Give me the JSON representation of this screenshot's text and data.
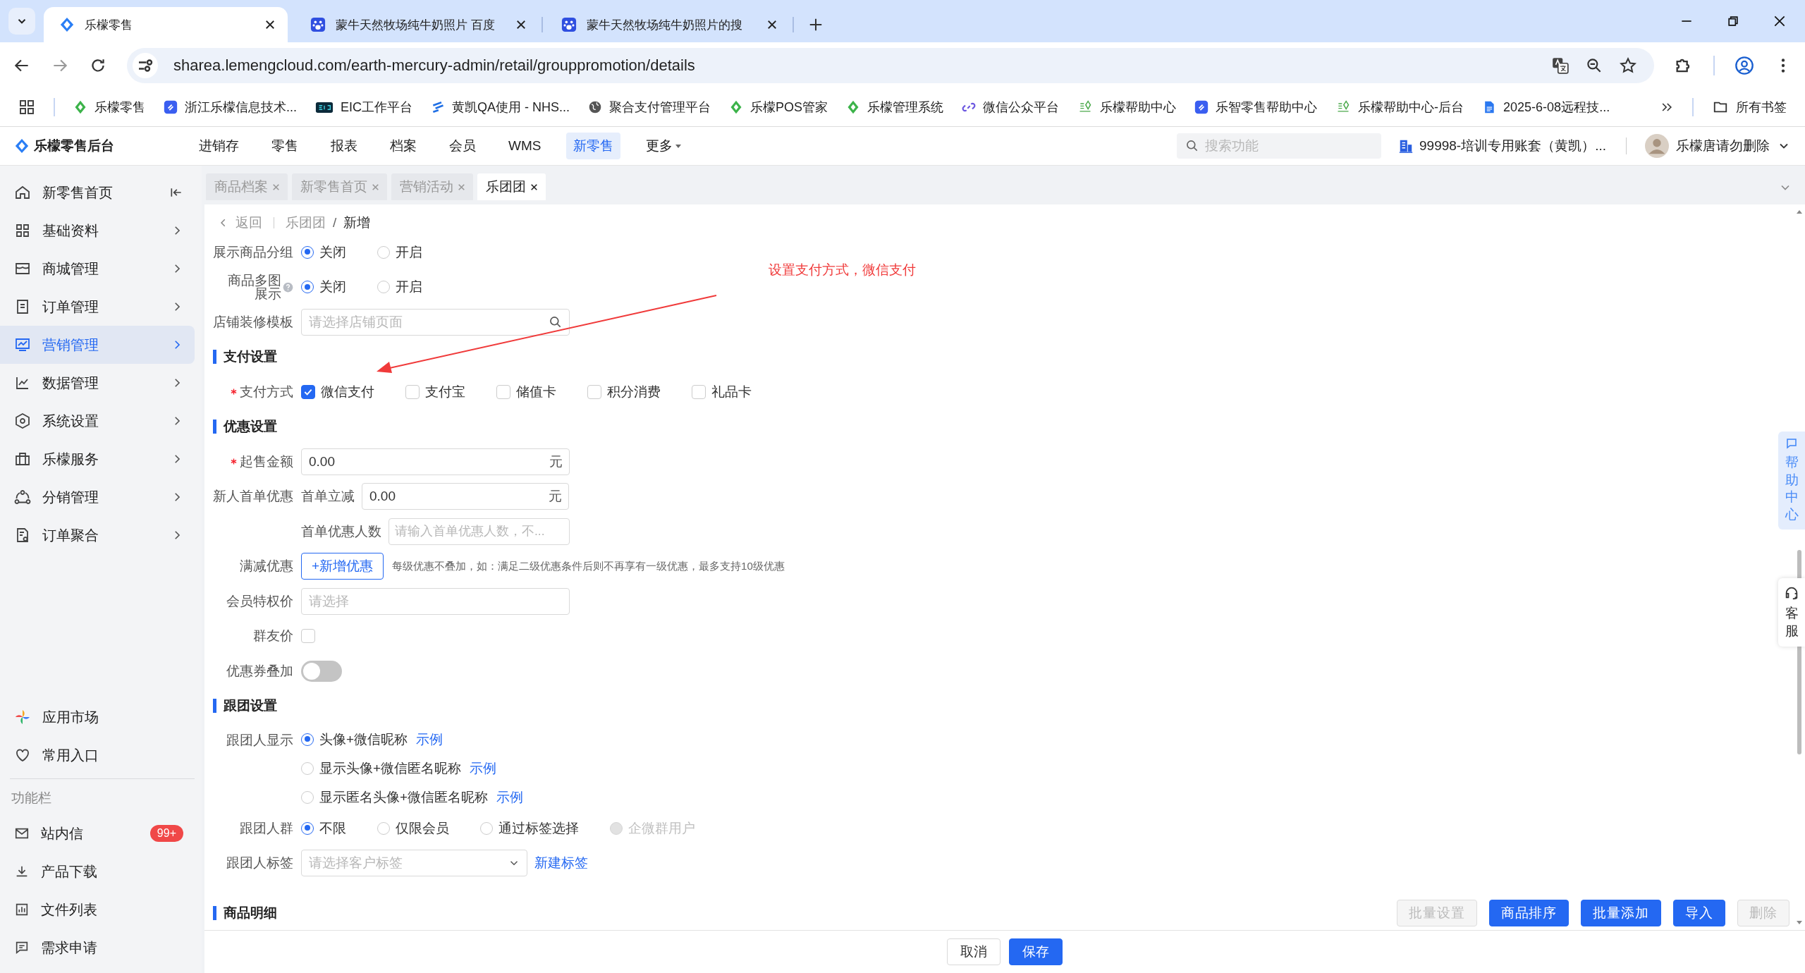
{
  "browser": {
    "tabs": [
      {
        "title": "乐檬零售",
        "selected": true
      },
      {
        "title": "蒙牛天然牧场纯牛奶照片 百度",
        "selected": false
      },
      {
        "title": "蒙牛天然牧场纯牛奶照片的搜",
        "selected": false
      }
    ],
    "url": "sharea.lemengcloud.com/earth-mercury-admin/retail/grouppromotion/details",
    "bookmarks": [
      {
        "label": "乐檬零售",
        "kind": "diamond"
      },
      {
        "label": "浙江乐檬信息技术...",
        "kind": "app"
      },
      {
        "label": "EIC工作平台",
        "kind": "badge"
      },
      {
        "label": "黄凯QA使用 - NHS...",
        "kind": "bars"
      },
      {
        "label": "聚合支付管理平台",
        "kind": "globe"
      },
      {
        "label": "乐檬POS管家",
        "kind": "diamond"
      },
      {
        "label": "乐檬管理系统",
        "kind": "diamond"
      },
      {
        "label": "微信公众平台",
        "kind": "link"
      },
      {
        "label": "乐檬帮助中心",
        "kind": "leaf"
      },
      {
        "label": "乐智零售帮助中心",
        "kind": "app"
      },
      {
        "label": "乐檬帮助中心-后台",
        "kind": "leaf"
      },
      {
        "label": "2025-6-08远程技...",
        "kind": "doc"
      }
    ],
    "all_bookmarks": "所有书签"
  },
  "header": {
    "title": "乐檬零售后台",
    "nav": [
      {
        "label": "进销存",
        "selected": false,
        "dropdown": false
      },
      {
        "label": "零售",
        "selected": false,
        "dropdown": false
      },
      {
        "label": "报表",
        "selected": false,
        "dropdown": false
      },
      {
        "label": "档案",
        "selected": false,
        "dropdown": false
      },
      {
        "label": "会员",
        "selected": false,
        "dropdown": false
      },
      {
        "label": "WMS",
        "selected": false,
        "dropdown": false
      },
      {
        "label": "新零售",
        "selected": true,
        "dropdown": false
      },
      {
        "label": "更多",
        "selected": false,
        "dropdown": true
      }
    ],
    "search": {
      "placeholder": "搜索功能"
    },
    "account": "99998-培训专用账套（黄凯）...",
    "user": "乐檬唐请勿删除"
  },
  "sidebar": {
    "home": "新零售首页",
    "items": [
      {
        "label": "基础资料",
        "selected": false
      },
      {
        "label": "商城管理",
        "selected": false
      },
      {
        "label": "订单管理",
        "selected": false
      },
      {
        "label": "营销管理",
        "selected": true
      },
      {
        "label": "数据管理",
        "selected": false
      },
      {
        "label": "系统设置",
        "selected": false
      },
      {
        "label": "乐檬服务",
        "selected": false
      },
      {
        "label": "分销管理",
        "selected": false
      },
      {
        "label": "订单聚合",
        "selected": false
      }
    ],
    "shortcuts": [
      "应用市场",
      "常用入口"
    ],
    "tools_title": "功能栏",
    "tools": [
      {
        "label": "站内信",
        "badge": "99+"
      },
      {
        "label": "产品下载"
      },
      {
        "label": "文件列表"
      },
      {
        "label": "需求申请"
      }
    ]
  },
  "page_tabs": [
    {
      "label": "商品档案",
      "selected": false
    },
    {
      "label": "新零售首页",
      "selected": false
    },
    {
      "label": "营销活动",
      "selected": false
    },
    {
      "label": "乐团团",
      "selected": true
    }
  ],
  "breadcrumb": {
    "back": "返回",
    "path": [
      "乐团团",
      "新增"
    ],
    "separator": "/"
  },
  "sections": [
    {
      "rows": [
        {
          "kind": "radio",
          "label": "展示商品分组",
          "required": false,
          "help": false,
          "options": [
            {
              "label": "关闭",
              "selected": true,
              "disabled": false
            },
            {
              "label": "开启",
              "selected": false,
              "disabled": false
            }
          ]
        },
        {
          "kind": "radio",
          "label": "商品多图展示",
          "required": false,
          "help": true,
          "options": [
            {
              "label": "关闭",
              "selected": true,
              "disabled": false
            },
            {
              "label": "开启",
              "selected": false,
              "disabled": false
            }
          ]
        },
        {
          "kind": "search",
          "label": "店铺装修模板",
          "required": false,
          "help": false,
          "placeholder": "请选择店铺页面"
        }
      ]
    },
    {
      "title": "支付设置",
      "rows": [
        {
          "kind": "checkboxes",
          "label": "支付方式",
          "required": true,
          "help": false,
          "options": [
            {
              "label": "微信支付",
              "checked": true
            },
            {
              "label": "支付宝",
              "checked": false
            },
            {
              "label": "储值卡",
              "checked": false
            },
            {
              "label": "积分消费",
              "checked": false
            },
            {
              "label": "礼品卡",
              "checked": false
            }
          ]
        }
      ]
    },
    {
      "title": "优惠设置",
      "rows": [
        {
          "kind": "amount",
          "label": "起售金额",
          "required": true,
          "help": false,
          "value": "0.00",
          "unit": "元"
        },
        {
          "kind": "sub_amount",
          "label": "新人首单优惠",
          "required": false,
          "help": false,
          "sublabel": "首单立减",
          "value": "0.00",
          "unit": "元"
        },
        {
          "kind": "sub_input",
          "required": false,
          "help": false,
          "sublabel": "首单优惠人数",
          "placeholder": "请输入首单优惠人数，不..."
        },
        {
          "kind": "add_button",
          "label": "满减优惠",
          "required": false,
          "help": false,
          "button": "+新增优惠",
          "hint": "每级优惠不叠加，如：满足二级优惠条件后则不再享有一级优惠，最多支持10级优惠"
        },
        {
          "kind": "select",
          "label": "会员特权价",
          "required": false,
          "help": false,
          "placeholder": "请选择"
        },
        {
          "kind": "checkbox",
          "label": "群友价",
          "required": false,
          "help": false,
          "checked": false
        },
        {
          "kind": "switch",
          "label": "优惠券叠加",
          "required": false,
          "help": false,
          "on": false
        }
      ]
    },
    {
      "title": "跟团设置",
      "rows": [
        {
          "kind": "radio_list",
          "label": "跟团人显示",
          "required": false,
          "help": false,
          "options": [
            {
              "label": "头像+微信昵称",
              "link": "示例",
              "selected": true
            },
            {
              "label": "显示头像+微信匿名昵称",
              "link": "示例",
              "selected": false
            },
            {
              "label": "显示匿名头像+微信匿名昵称",
              "link": "示例",
              "selected": false
            }
          ]
        },
        {
          "kind": "radio",
          "label": "跟团人群",
          "required": false,
          "help": false,
          "options": [
            {
              "label": "不限",
              "selected": true,
              "disabled": false
            },
            {
              "label": "仅限会员",
              "selected": false,
              "disabled": false
            },
            {
              "label": "通过标签选择",
              "selected": false,
              "disabled": false
            },
            {
              "label": "企微群用户",
              "selected": false,
              "disabled": true
            }
          ]
        },
        {
          "kind": "select_link",
          "label": "跟团人标签",
          "required": false,
          "help": false,
          "placeholder": "请选择客户标签",
          "link": "新建标签"
        }
      ]
    },
    {
      "title": "商品明细",
      "actions": [
        {
          "label": "批量设置",
          "disabled": true
        },
        {
          "label": "商品排序",
          "disabled": false
        },
        {
          "label": "批量添加",
          "disabled": false
        },
        {
          "label": "导入",
          "disabled": false
        },
        {
          "label": "删除",
          "disabled": true
        }
      ]
    }
  ],
  "annotation": "设置支付方式，微信支付",
  "footer": [
    {
      "label": "取消",
      "primary": false
    },
    {
      "label": "保存",
      "primary": true
    }
  ],
  "help_float": {
    "help": "帮助中心",
    "service": "客服"
  }
}
